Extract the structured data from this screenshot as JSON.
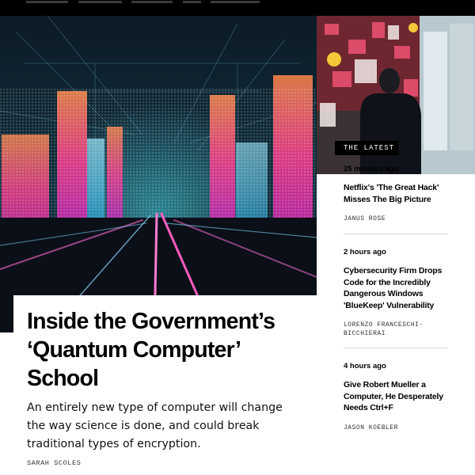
{
  "nav": {
    "items": [
      "",
      "",
      "",
      "",
      ""
    ]
  },
  "latest": {
    "tag": "THE LATEST",
    "items": [
      {
        "time": "25 minutes ago",
        "title": "Netflix's 'The Great Hack' Misses The Big Picture",
        "author": "JANUS ROSE"
      },
      {
        "time": "2 hours ago",
        "title": "Cybersecurity Firm Drops Code for the Incredibly Dangerous Windows 'BlueKeep' Vulnerability",
        "author": "LORENZO FRANCESCHI-BICCHIERAI"
      },
      {
        "time": "4 hours ago",
        "title": "Give Robert Mueller a Computer, He Desperately Needs Ctrl+F",
        "author": "JASON KOEBLER"
      }
    ]
  },
  "feature": {
    "title": "Inside the Government’s ‘Quantum Computer’ School",
    "dek": "An entirely new type of computer will change the way science is done, and could break traditional types of encryption.",
    "author": "SARAH SCOLES"
  },
  "colors": {
    "background": "#ffffff",
    "nav": "#000000",
    "tag": "#000000",
    "divider": "#d8d8d8"
  }
}
